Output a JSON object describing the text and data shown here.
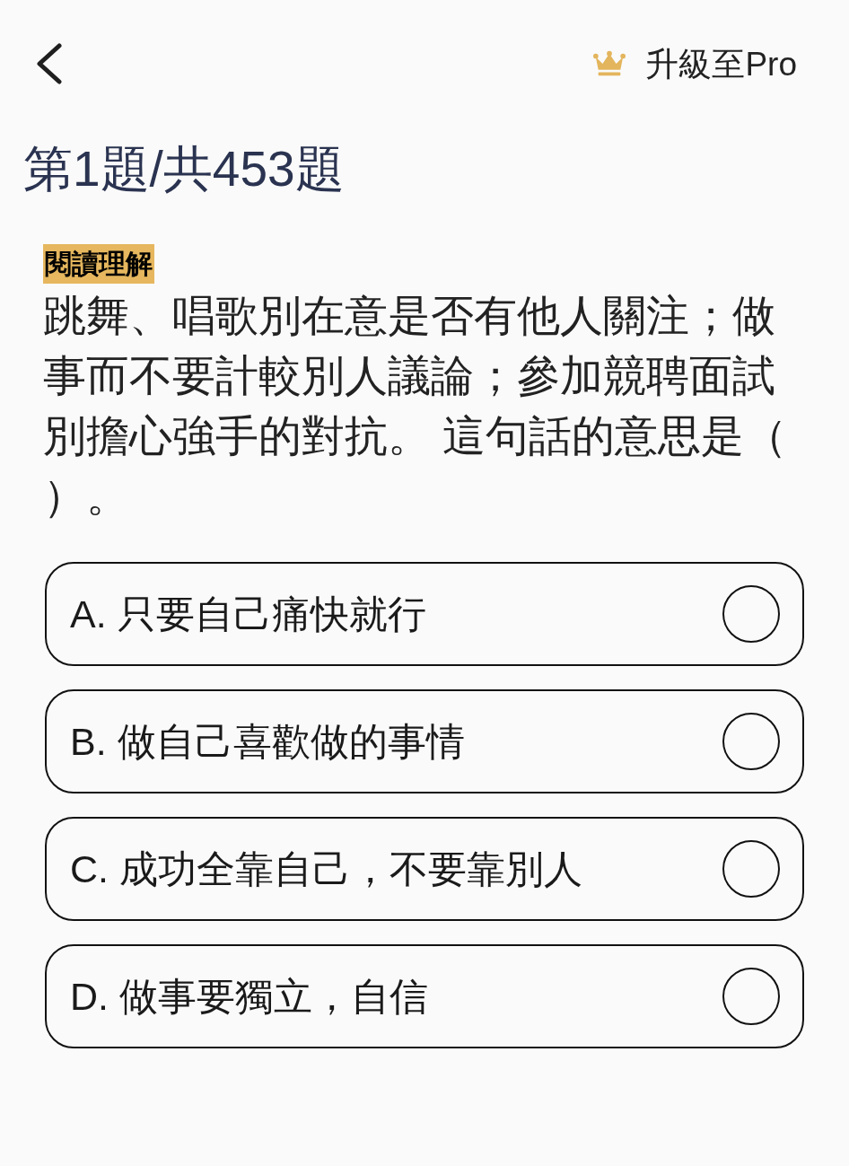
{
  "header": {
    "upgrade_label": "升級至Pro"
  },
  "progress": "第1題/共453題",
  "question": {
    "category": "閱讀理解",
    "text": "跳舞、唱歌別在意是否有他人關注；做事而不要計較別人議論；參加競聘面試別擔心強手的對抗。 這句話的意思是（）。"
  },
  "options": [
    {
      "label": "A. 只要自己痛快就行",
      "selected": false
    },
    {
      "label": "B. 做自己喜歡做的事情",
      "selected": false
    },
    {
      "label": "C. 成功全靠自己，不要靠別人",
      "selected": false
    },
    {
      "label": "D. 做事要獨立，自信",
      "selected": false
    }
  ]
}
